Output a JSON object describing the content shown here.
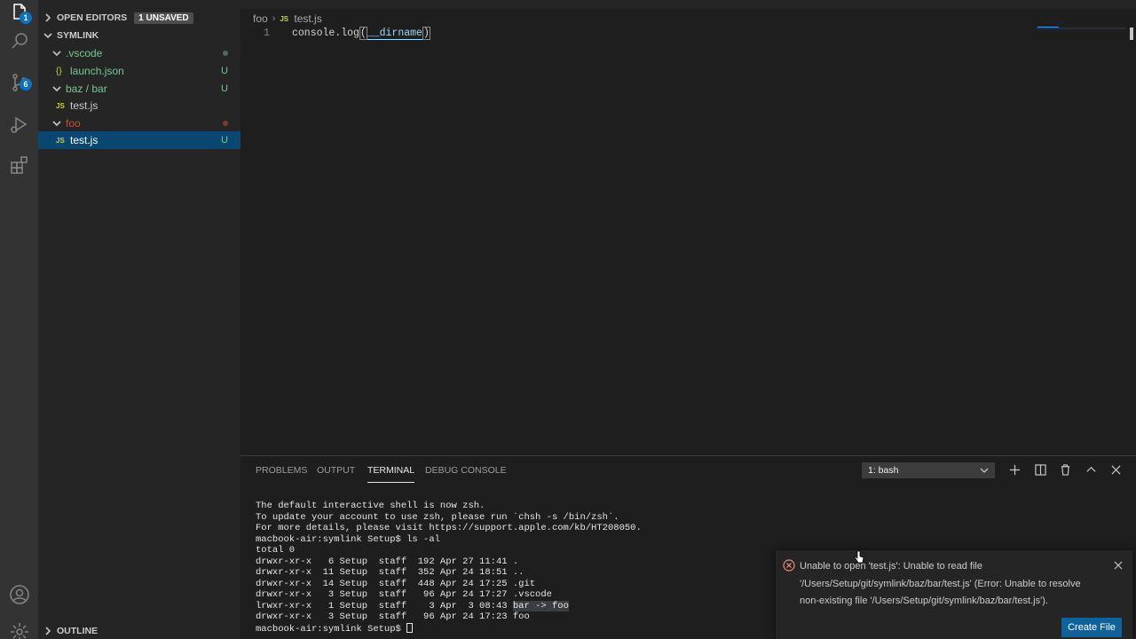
{
  "activity_bar": {
    "explorer_badge": "1",
    "scm_badge": "6"
  },
  "sidebar": {
    "open_editors": {
      "label": "OPEN EDITORS",
      "badge": "1 UNSAVED"
    },
    "folder": {
      "label": "SYMLINK"
    },
    "items": [
      {
        "label": ".vscode",
        "status": "",
        "color": "#73c991"
      },
      {
        "label": "launch.json",
        "status": "U",
        "color": "#73c991"
      },
      {
        "label": "baz / bar",
        "status": "U",
        "color": "#73c991"
      },
      {
        "label": "test.js",
        "status": "",
        "color": "#cccccc"
      },
      {
        "label": "foo",
        "status": "",
        "color": "#c74e39"
      },
      {
        "label": "test.js",
        "status": "U",
        "color": "#73c991"
      }
    ],
    "outline": {
      "label": "OUTLINE"
    }
  },
  "editor": {
    "breadcrumb": {
      "folder": "foo",
      "file": "test.js"
    },
    "line_number": "1",
    "code": {
      "prefix": "console.log",
      "open": "(",
      "arg": "__dirname",
      "close": ")"
    }
  },
  "panel": {
    "tabs": [
      {
        "label": "PROBLEMS"
      },
      {
        "label": "OUTPUT"
      },
      {
        "label": "TERMINAL"
      },
      {
        "label": "DEBUG CONSOLE"
      }
    ],
    "terminal_select": "1: bash",
    "terminal_lines": {
      "l1": "The default interactive shell is now zsh.",
      "l2": "To update your account to use zsh, please run `chsh -s /bin/zsh`.",
      "l3": "For more details, please visit https://support.apple.com/kb/HT208050.",
      "l4": "macbook-air:symlink Setup$ ls -al",
      "l5": "total 0",
      "l6": "drwxr-xr-x   6 Setup  staff  192 Apr 27 11:41 .",
      "l7": "drwxr-xr-x  11 Setup  staff  352 Apr 24 18:51 ..",
      "l8": "drwxr-xr-x  14 Setup  staff  448 Apr 24 17:25 .git",
      "l9": "drwxr-xr-x   3 Setup  staff   96 Apr 24 17:27 .vscode",
      "l10_prefix": "lrwxr-xr-x   1 Setup  staff    3 Apr  3 08:43 ",
      "l10_link": "bar -> foo",
      "l11": "drwxr-xr-x   3 Setup  staff   96 Apr 24 17:23 foo",
      "l12": "macbook-air:symlink Setup$ "
    }
  },
  "notification": {
    "message_line1": "Unable to open 'test.js': Unable to read file",
    "message_line2": "'/Users/Setup/git/symlink/baz/bar/test.js' (Error: Unable to resolve",
    "message_line3": "non-existing file '/Users/Setup/git/symlink/baz/bar/test.js').",
    "button": "Create File"
  }
}
